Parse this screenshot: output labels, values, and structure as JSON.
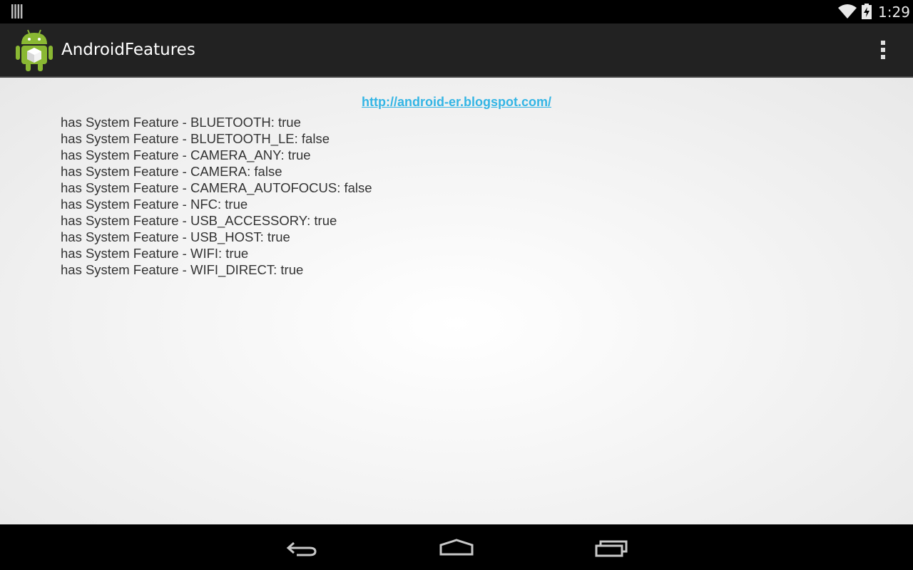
{
  "status_bar": {
    "time": "1:29",
    "notification_icon": "notification-bars-icon",
    "wifi_icon": "wifi-icon",
    "battery_icon": "battery-charging-icon"
  },
  "action_bar": {
    "title": "AndroidFeatures",
    "app_icon": "android-robot-icon",
    "overflow_icon": "overflow-menu-icon"
  },
  "content": {
    "link": "http://android-er.blogspot.com/",
    "features": [
      "has System Feature - BLUETOOTH: true",
      "has System Feature - BLUETOOTH_LE: false",
      "has System Feature - CAMERA_ANY: true",
      "has System Feature - CAMERA: false",
      "has System Feature - CAMERA_AUTOFOCUS: false",
      "has System Feature - NFC: true",
      "has System Feature - USB_ACCESSORY: true",
      "has System Feature - USB_HOST: true",
      "has System Feature - WIFI: true",
      "has System Feature - WIFI_DIRECT: true"
    ]
  },
  "nav_bar": {
    "back_icon": "back-icon",
    "home_icon": "home-icon",
    "recents_icon": "recent-apps-icon"
  },
  "colors": {
    "link": "#33b5e5",
    "action_bar": "#222222",
    "text": "#333333"
  }
}
